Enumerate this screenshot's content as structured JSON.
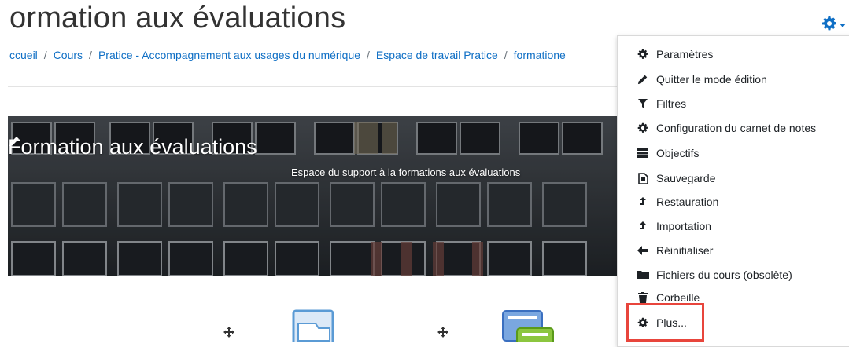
{
  "page": {
    "title": "ormation aux évaluations"
  },
  "breadcrumb": {
    "items": [
      "ccueil",
      "Cours",
      "Pratice - Accompagnement aux usages du numérique",
      "Espace de travail Pratice",
      "formatione"
    ],
    "separator": "/"
  },
  "banner": {
    "title": "Formation aux évaluations",
    "description": "Espace du support à la formations aux évaluations"
  },
  "menu": {
    "items": [
      {
        "label": "Paramètres",
        "icon": "gear-icon"
      },
      {
        "label": "Quitter le mode édition",
        "icon": "pencil-icon"
      },
      {
        "label": "Filtres",
        "icon": "filter-icon"
      },
      {
        "label": "Configuration du carnet de notes",
        "icon": "gear-icon"
      },
      {
        "label": "Objectifs",
        "icon": "list-icon"
      },
      {
        "label": "Sauvegarde",
        "icon": "file-icon"
      },
      {
        "label": "Restauration",
        "icon": "upload-icon"
      },
      {
        "label": "Importation",
        "icon": "upload-icon"
      },
      {
        "label": "Réinitialiser",
        "icon": "arrow-left-icon"
      },
      {
        "label": "Fichiers du cours (obsolète)",
        "icon": "folder-icon"
      },
      {
        "label": "Corbeille",
        "icon": "trash-icon"
      },
      {
        "label": "Plus...",
        "icon": "gear-icon"
      }
    ]
  },
  "colors": {
    "link": "#0f6fc5",
    "highlight": "#e8453c"
  }
}
